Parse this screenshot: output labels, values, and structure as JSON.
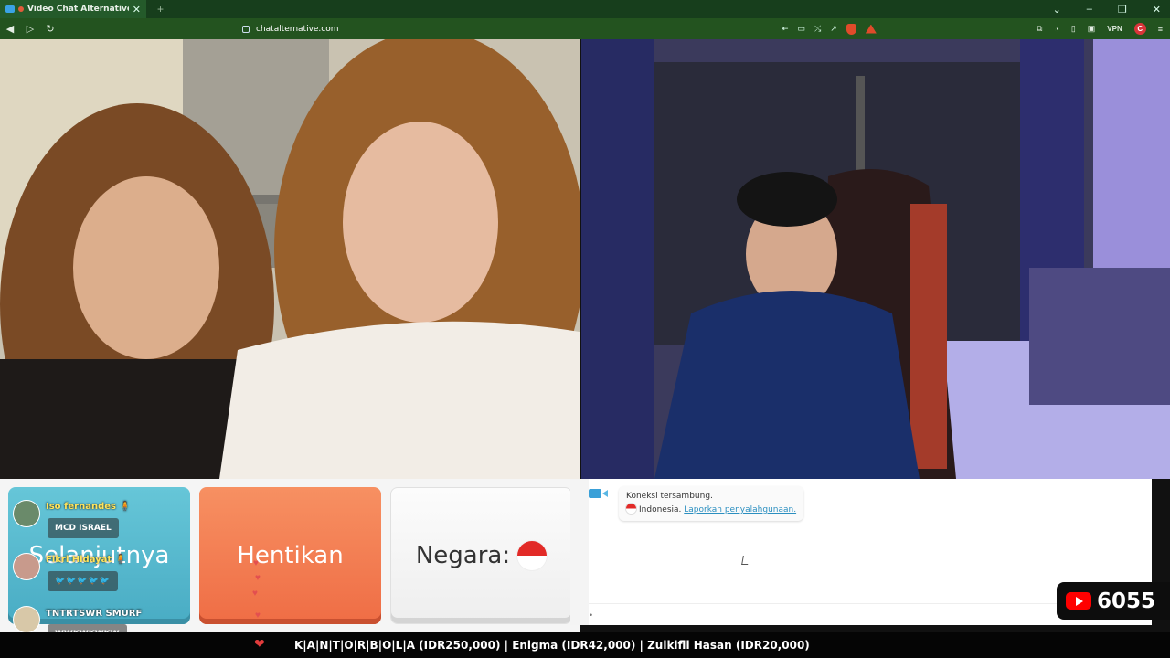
{
  "browser": {
    "tab_title": "Video Chat Alternative - A Fr",
    "tab_close": "✕",
    "new_tab": "+",
    "url": "chatalternative.com",
    "vpn_label": "VPN"
  },
  "controls": {
    "next_label": "Selanjutnya",
    "stop_label": "Hentikan",
    "country_label": "Negara:"
  },
  "chat": {
    "status": "Koneksi tersambung.",
    "country": "Indonesia.",
    "report_link": "Laporkan penyalahgunaan.",
    "input_placeholder": "•"
  },
  "overlay": {
    "feed": [
      {
        "name": "Iso fernandes 🧍",
        "message": "MCD ISRAEL"
      },
      {
        "name": "Fikri Hidayat 🧍",
        "message": "🐦🐦🐦🐦🐦"
      },
      {
        "name": "TNTRTSWR SMURF",
        "message": "WWKWKWKW"
      }
    ],
    "viewer_count": "6055",
    "ticker": "K|A|N|T|O|R|B|O|L|A (IDR250,000) | Enigma (IDR42,000) | Zulkifli Hasan (IDR20,000)"
  },
  "colors": {
    "next": "#4fb3c9",
    "stop": "#f27a4e",
    "link": "#2b8fc0",
    "youtube_red": "#ff0000"
  }
}
